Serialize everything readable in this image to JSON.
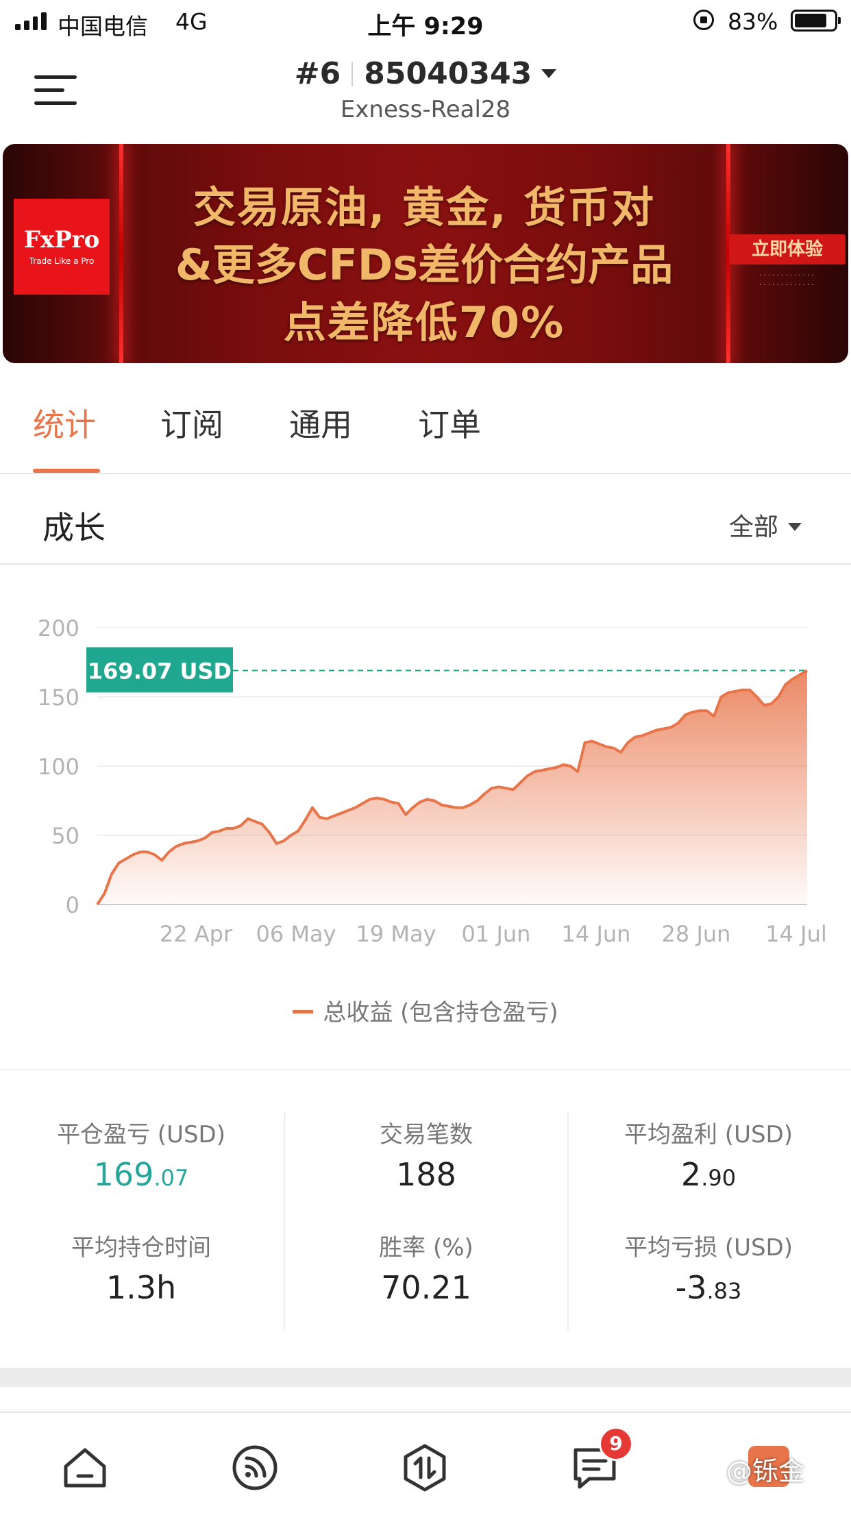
{
  "status_bar": {
    "carrier": "中国电信",
    "network": "4G",
    "time": "上午 9:29",
    "battery_percent": "83%",
    "battery_level": 0.83
  },
  "header": {
    "rank": "#6",
    "account_number": "85040343",
    "server": "Exness-Real28"
  },
  "banner": {
    "brand": "FxPro",
    "brand_tagline": "Trade Like a Pro",
    "headline_line1": "交易原油, 黄金, 货币对",
    "headline_line2": "&更多CFDs差价合约产品",
    "headline_line3": "点差降低70%",
    "cta": "立即体验"
  },
  "tabs": [
    "统计",
    "订阅",
    "通用",
    "订单"
  ],
  "active_tab": 0,
  "growth": {
    "title": "成长",
    "range": "全部"
  },
  "chart_data": {
    "type": "area",
    "current_label": "169.07 USD",
    "x_tick_labels": [
      "22 Apr",
      "06 May",
      "19 May",
      "01 Jun",
      "14 Jun",
      "28 Jun",
      "14 Jul"
    ],
    "y_ticks": [
      0,
      50,
      100,
      150,
      200
    ],
    "ylim": [
      0,
      200
    ],
    "series": [
      {
        "name": "总收益 (包含持仓盈亏)",
        "values": [
          0,
          8,
          22,
          30,
          33,
          36,
          38,
          38,
          36,
          32,
          38,
          42,
          44,
          45,
          46,
          48,
          52,
          53,
          55,
          55,
          57,
          62,
          60,
          58,
          52,
          44,
          46,
          50,
          53,
          61,
          70,
          63,
          62,
          64,
          66,
          68,
          70,
          73,
          76,
          77,
          76,
          74,
          73,
          65,
          70,
          74,
          76,
          75,
          72,
          71,
          70,
          70,
          72,
          75,
          80,
          84,
          85,
          84,
          83,
          88,
          93,
          96,
          97,
          98,
          99,
          101,
          100,
          96,
          117,
          118,
          116,
          114,
          113,
          110,
          117,
          121,
          122,
          124,
          126,
          127,
          128,
          131,
          137,
          139,
          140,
          140,
          136,
          150,
          153,
          154,
          155,
          155,
          150,
          144,
          145,
          150,
          159,
          163,
          166,
          169.07
        ]
      }
    ],
    "color": "#e8744a",
    "label_color": "#1fa88f"
  },
  "stats": {
    "closed_pnl": {
      "label": "平仓盈亏 (USD)",
      "int": "169",
      "dec": ".07"
    },
    "trade_count": {
      "label": "交易笔数",
      "value": "188"
    },
    "avg_profit": {
      "label": "平均盈利 (USD)",
      "int": "2",
      "dec": ".90"
    },
    "avg_hold_time": {
      "label": "平均持仓时间",
      "value": "1.3h"
    },
    "win_rate": {
      "label": "胜率 (%)",
      "value": "70.21"
    },
    "avg_loss": {
      "label": "平均亏损 (USD)",
      "int": "-3",
      "dec": ".83"
    }
  },
  "bottom_nav": {
    "messages_badge": "9",
    "watermark": "@铄金"
  }
}
